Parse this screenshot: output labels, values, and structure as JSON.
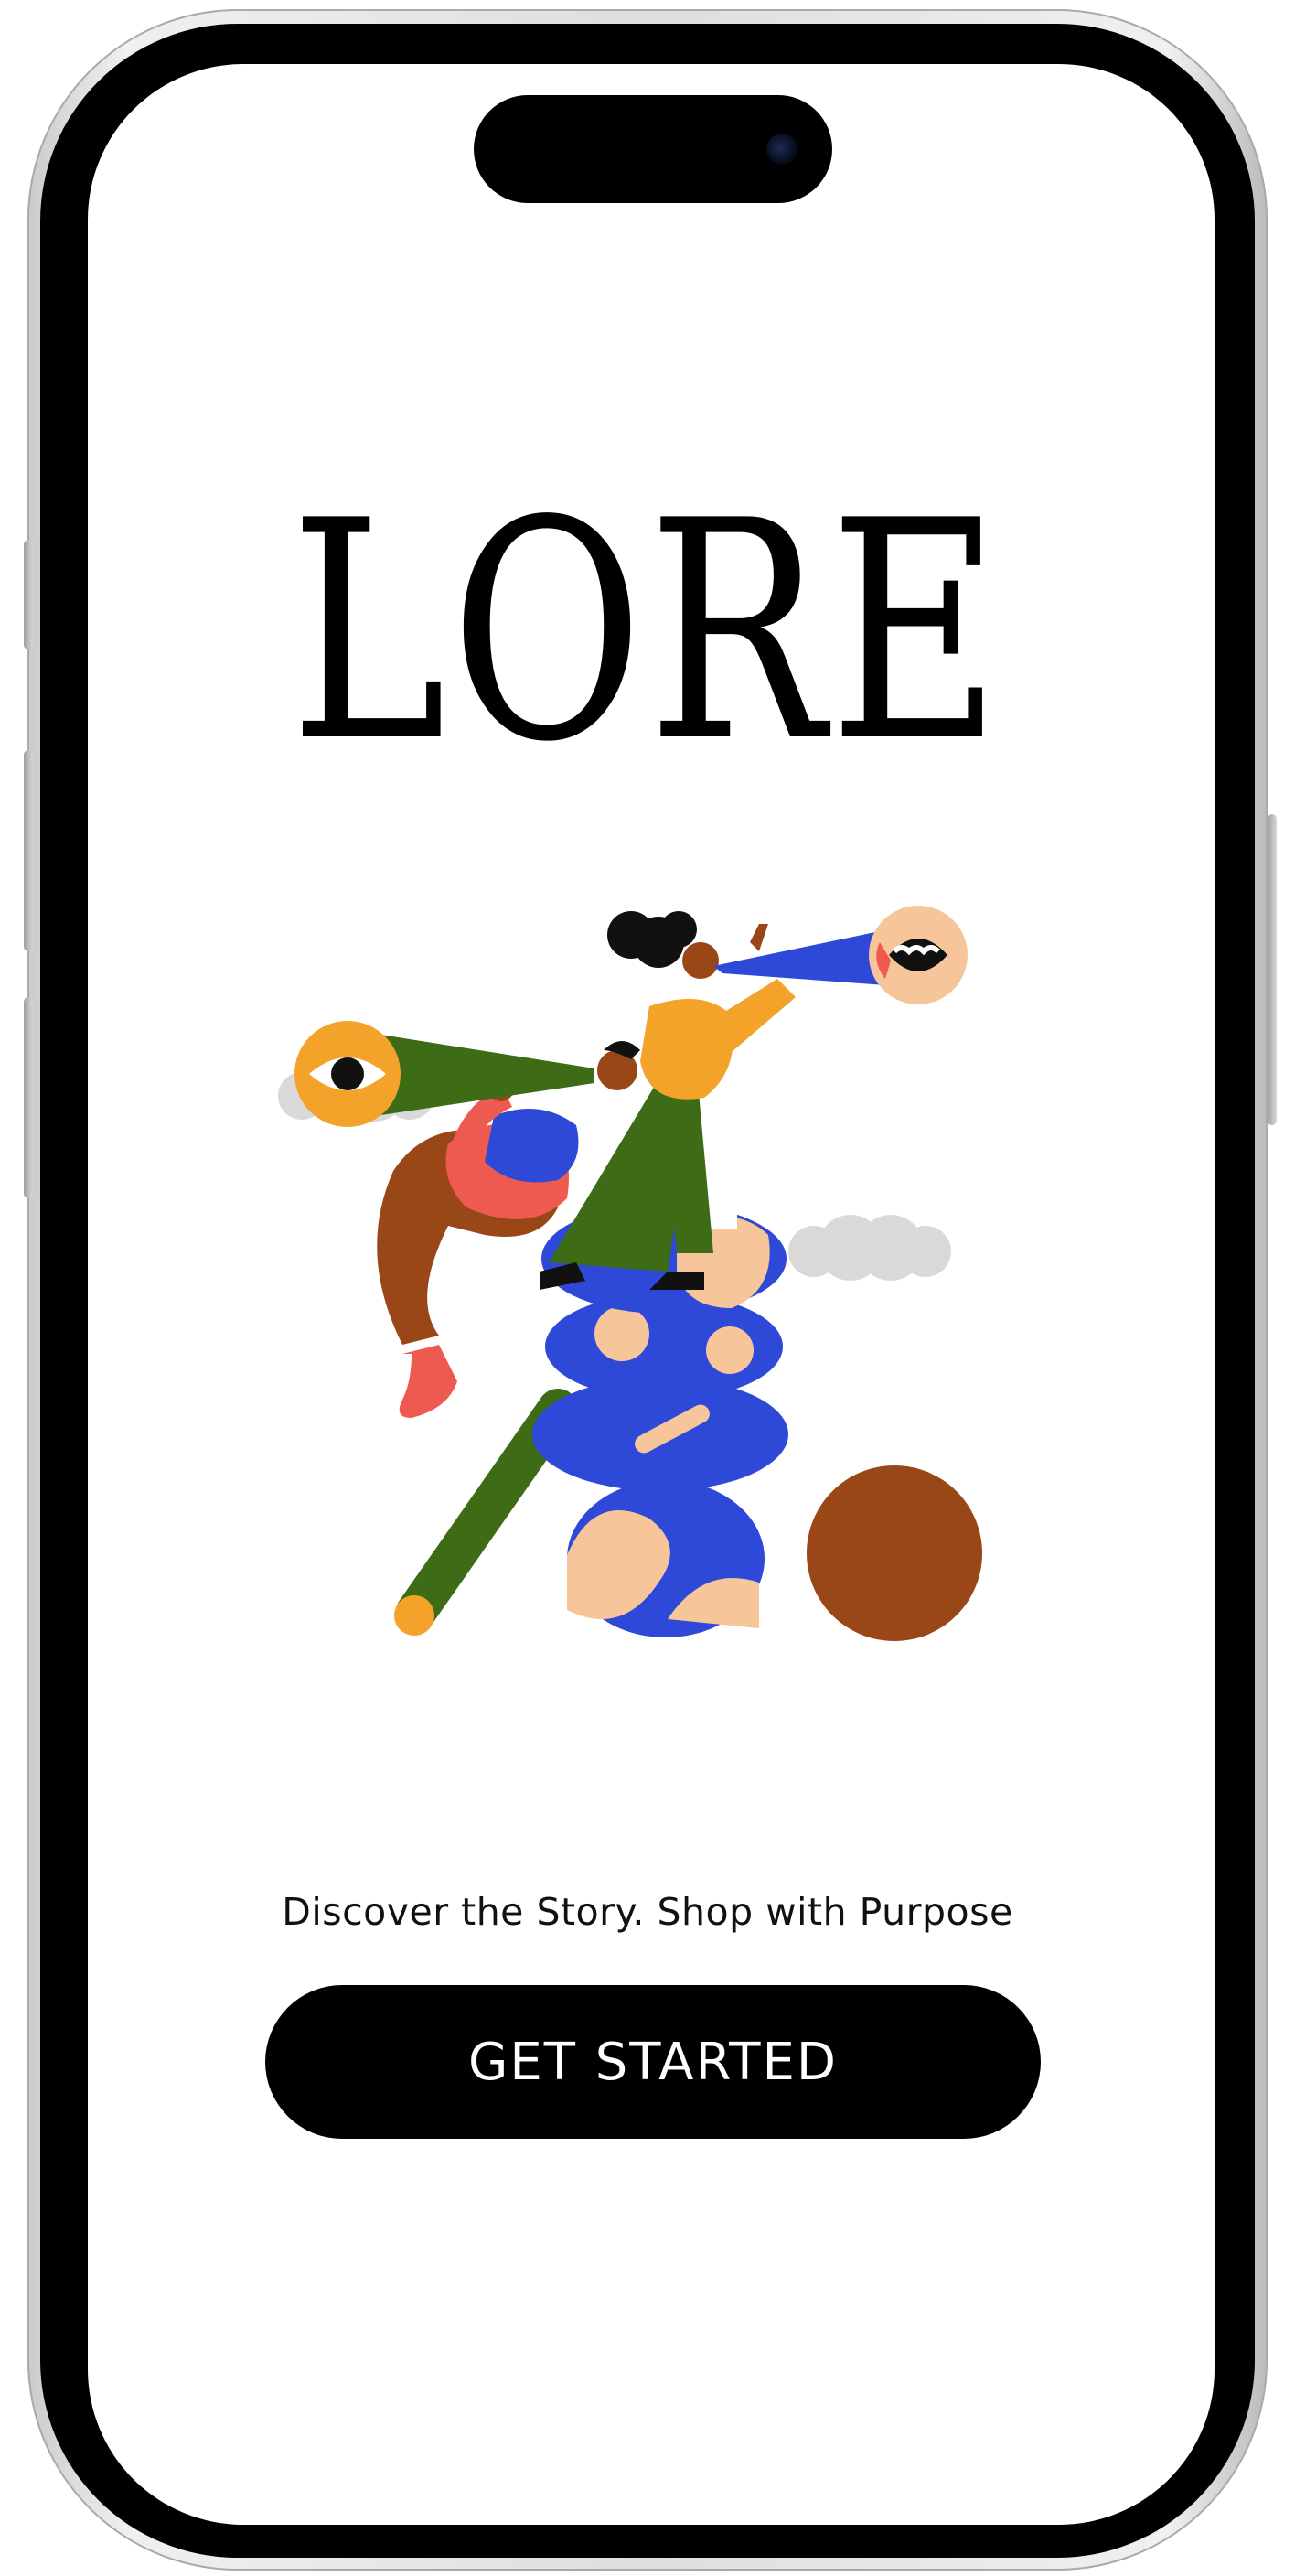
{
  "app": {
    "brand_title": "LORE",
    "tagline": "Discover the Story. Shop with Purpose",
    "cta_label": "GET STARTED"
  },
  "illustration": {
    "subject": "two people with telescopes on stacked rocks",
    "icons": [
      "eye-icon",
      "mouth-icon"
    ]
  },
  "colors": {
    "background": "#ffffff",
    "button_bg": "#000000",
    "button_text": "#ffffff",
    "title_text": "#000000",
    "accent_blue": "#2e49d8",
    "accent_orange": "#f4a32a",
    "accent_green": "#3e6b16",
    "accent_brown": "#9a4718",
    "accent_red": "#ef5a50",
    "accent_peach": "#f6c59a"
  }
}
